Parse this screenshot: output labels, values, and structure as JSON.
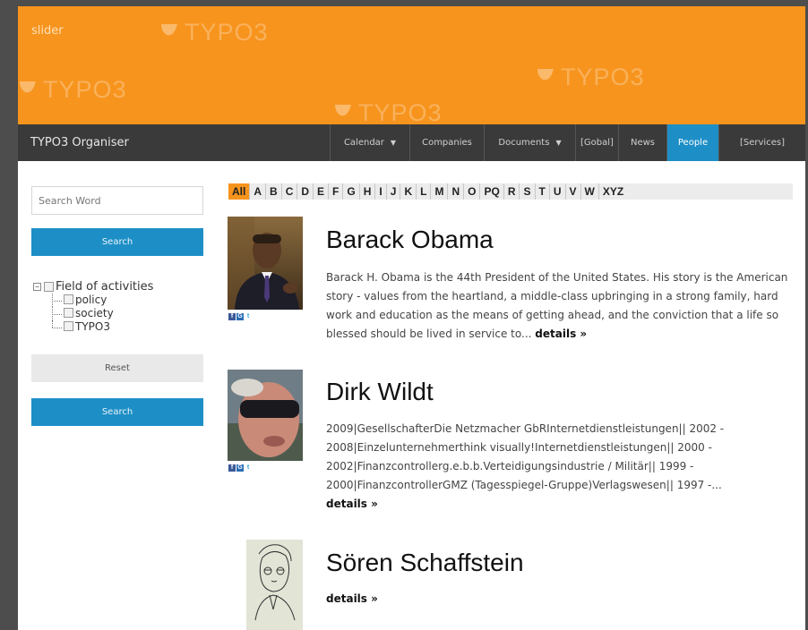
{
  "slider": {
    "label": "slider",
    "watermark_text": "TYPO3"
  },
  "navbar": {
    "brand": "TYPO3 Organiser",
    "items": [
      {
        "label": "Calendar",
        "has_caret": true,
        "active": false
      },
      {
        "label": "Companies",
        "has_caret": false,
        "active": false
      },
      {
        "label": "Documents",
        "has_caret": true,
        "active": false
      },
      {
        "label": "[Gobal]",
        "has_caret": false,
        "active": false
      },
      {
        "label": "News",
        "has_caret": false,
        "active": false
      },
      {
        "label": "People",
        "has_caret": false,
        "active": true
      },
      {
        "label": "[Services]",
        "has_caret": false,
        "active": false
      }
    ],
    "caret_icon": "chevron-down-icon"
  },
  "sidebar": {
    "search_placeholder": "Search Word",
    "search_button": "Search",
    "tree": {
      "root": "Field of activities",
      "children": [
        "policy",
        "society",
        "TYPO3"
      ]
    },
    "reset_button": "Reset",
    "search_button_2": "Search"
  },
  "alphabet": {
    "active": "All",
    "letters": [
      "All",
      "A",
      "B",
      "C",
      "D",
      "E",
      "F",
      "G",
      "H",
      "I",
      "J",
      "K",
      "L",
      "M",
      "N",
      "O",
      "PQ",
      "R",
      "S",
      "T",
      "U",
      "V",
      "W",
      "XYZ"
    ]
  },
  "people": [
    {
      "name": "Barack Obama",
      "description": "Barack H. Obama is the 44th President of the United States. His story is the American story - values from the heartland, a middle-class upbringing in a strong family, hard work and education as the means of getting ahead, and the conviction that a life so blessed should be lived in service to...",
      "details": "details »",
      "social": [
        "facebook-icon",
        "google-icon",
        "twitter-icon"
      ]
    },
    {
      "name": "Dirk Wildt",
      "description": "2009|GesellschafterDie Netzmacher GbRInternetdienstleistungen|| 2002 - 2008|Einzelunternehmerthink visually!Internetdienstleistungen|| 2000 - 2002|Finanzcontrollerg.e.b.b.Verteidigungsindustrie / Militär|| 1999 - 2000|FinanzcontrollerGMZ (Tagesspiegel-Gruppe)Verlagswesen|| 1997 -...",
      "details": "details »",
      "social": [
        "facebook-icon",
        "google-icon",
        "twitter-icon"
      ]
    },
    {
      "name": "Sören Schaffstein",
      "description": "",
      "details": "details »",
      "social": []
    }
  ],
  "colors": {
    "accent_orange": "#f7941d",
    "accent_blue": "#1e8fc6",
    "nav_bg": "#3a3a3a"
  }
}
